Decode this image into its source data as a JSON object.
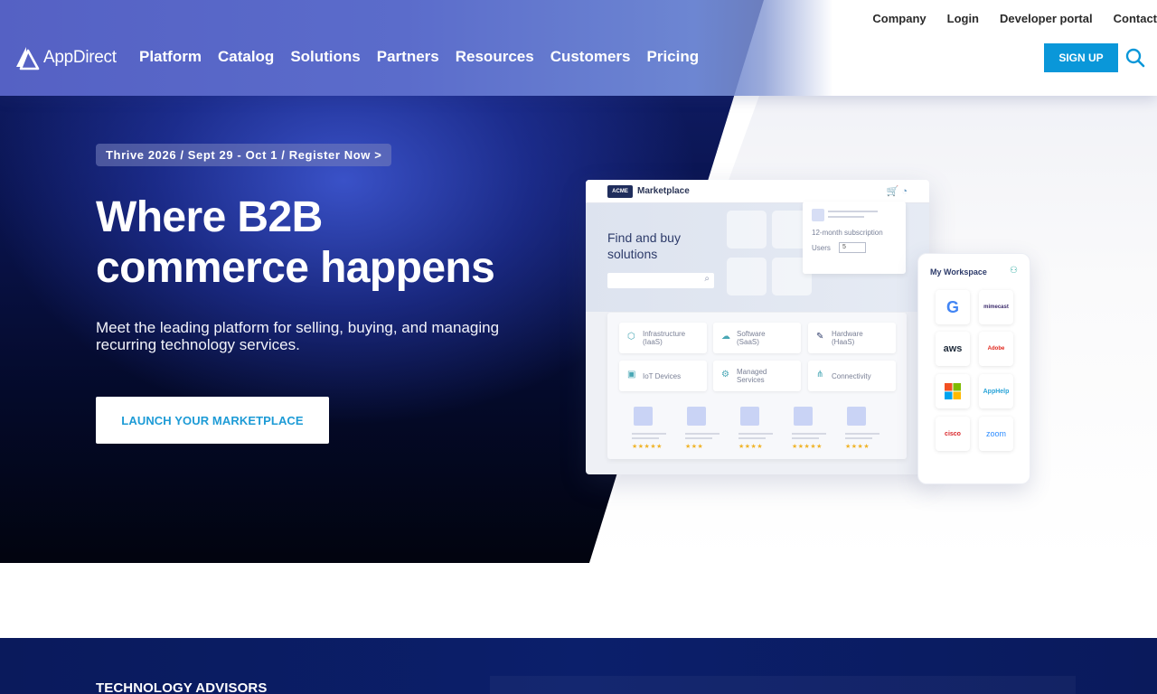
{
  "header": {
    "logo_text": "AppDirect",
    "main_nav": [
      {
        "label": "Platform"
      },
      {
        "label": "Catalog"
      },
      {
        "label": "Solutions"
      },
      {
        "label": "Partners"
      },
      {
        "label": "Resources"
      },
      {
        "label": "Customers"
      },
      {
        "label": "Pricing"
      }
    ],
    "top_nav": [
      {
        "label": "Company"
      },
      {
        "label": "Login"
      },
      {
        "label": "Developer portal"
      },
      {
        "label": "Contact"
      }
    ],
    "signup_label": "SIGN UP",
    "search_icon": "search-icon"
  },
  "hero": {
    "banner": "Thrive 2026 / Sept 29 - Oct 1 / Register Now >",
    "headline_line1": "Where B2B",
    "headline_line2": "commerce happens",
    "subhead": "Meet the leading platform for selling, buying, and managing recurring technology services.",
    "cta_label": "LAUNCH YOUR MARKETPLACE"
  },
  "mockup": {
    "brand_badge": "ACME",
    "title": "Marketplace",
    "find_line1": "Find and buy",
    "find_line2": "solutions",
    "subscription_text": "12-month subscription",
    "users_label": "Users",
    "users_value": "5",
    "categories": [
      {
        "line1": "Infrastructure",
        "line2": "(IaaS)",
        "icon": "cube-icon"
      },
      {
        "line1": "Software",
        "line2": "(SaaS)",
        "icon": "cloud-icon"
      },
      {
        "line1": "Hardware",
        "line2": "(HaaS)",
        "icon": "wrench-icon"
      },
      {
        "line1": "IoT Devices",
        "line2": "",
        "icon": "device-icon"
      },
      {
        "line1": "Managed",
        "line2": "Services",
        "icon": "gear-icon"
      },
      {
        "line1": "Connectivity",
        "line2": "",
        "icon": "share-icon"
      }
    ],
    "product_ratings": [
      "★★★★★",
      "★★★",
      "★★★★",
      "★★★★★",
      "★★★★"
    ]
  },
  "phone": {
    "title": "My Workspace",
    "apps": [
      {
        "label": "G",
        "color": "#4285f4"
      },
      {
        "label": "mimecast",
        "color": "#3b2a6b"
      },
      {
        "label": "aws",
        "color": "#232f3e"
      },
      {
        "label": "Adobe",
        "color": "#e1251b"
      },
      {
        "label": "microsoft",
        "color": "#f25022"
      },
      {
        "label": "AppHelp",
        "color": "#2aa4d8"
      },
      {
        "label": "cisco",
        "color": "#d9252a"
      },
      {
        "label": "zoom",
        "color": "#2d8cff"
      }
    ]
  },
  "section2": {
    "label": "TECHNOLOGY ADVISORS"
  }
}
